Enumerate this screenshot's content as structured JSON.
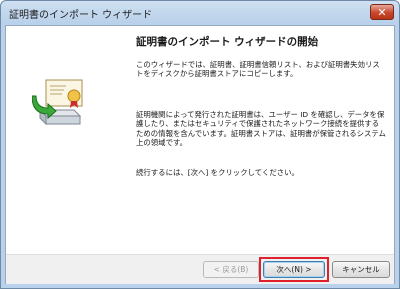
{
  "window": {
    "title": "証明書のインポート ウィザード",
    "close_label": "✕"
  },
  "content": {
    "heading": "証明書のインポート ウィザードの開始",
    "paragraph1": "このウィザードでは、証明書、証明書信頼リスト、および証明書失効リストをディスクから証明書ストアにコピーします。",
    "paragraph2": "証明機関によって発行された証明書は、ユーザー ID を確認し、データを保護したり、またはセキュリティで保護されたネットワーク接続を提供するための情報を含んでいます。証明書ストアは、証明書が保管されるシステム上の領域です。",
    "paragraph3": "続行するには、[次へ] をクリックしてください。"
  },
  "buttons": {
    "back": "< 戻る(B)",
    "next": "次へ(N) >",
    "cancel": "キャンセル"
  },
  "icons": {
    "certificate": "certificate-import-icon"
  },
  "colors": {
    "highlight": "#e0202a",
    "titlebar": "#b9d1ea"
  }
}
